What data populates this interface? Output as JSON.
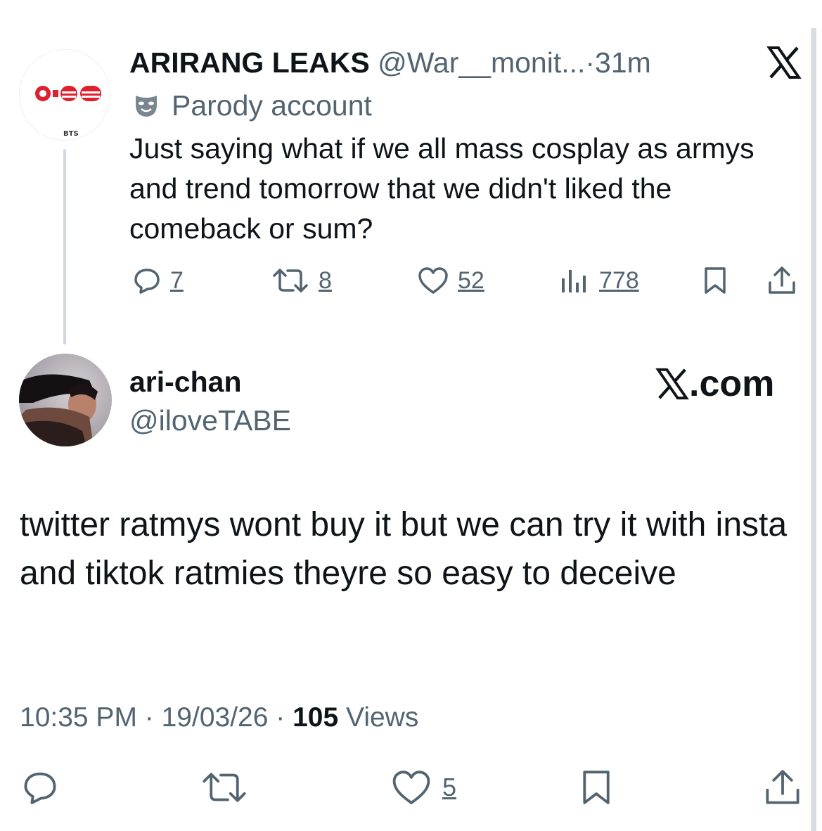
{
  "parent": {
    "avatar_label": "BTS",
    "name": "ARIRANG LEAKS",
    "handle": "@War__monit...",
    "separator": "·",
    "time": "31m",
    "parody_label": "Parody account",
    "text": "Just saying what if we all mass cosplay as armys and trend tomorrow that we didn't liked the comeback or sum?",
    "replies": "7",
    "reposts": "8",
    "likes": "52",
    "views": "778"
  },
  "reply": {
    "name": "ari-chan",
    "handle": "@iloveTABE",
    "brand": ".com",
    "text": "twitter ratmys wont buy it but we can try it with insta and tiktok ratmies theyre so easy to deceive",
    "time": "10:35 PM",
    "sep": " · ",
    "date": "19/03/26",
    "views_count": "105",
    "views_label": "Views",
    "likes": "5"
  },
  "colors": {
    "text": "#0f1419",
    "secondary": "#536471",
    "thread": "#cfd9de",
    "logo_red": "#e0202f"
  }
}
